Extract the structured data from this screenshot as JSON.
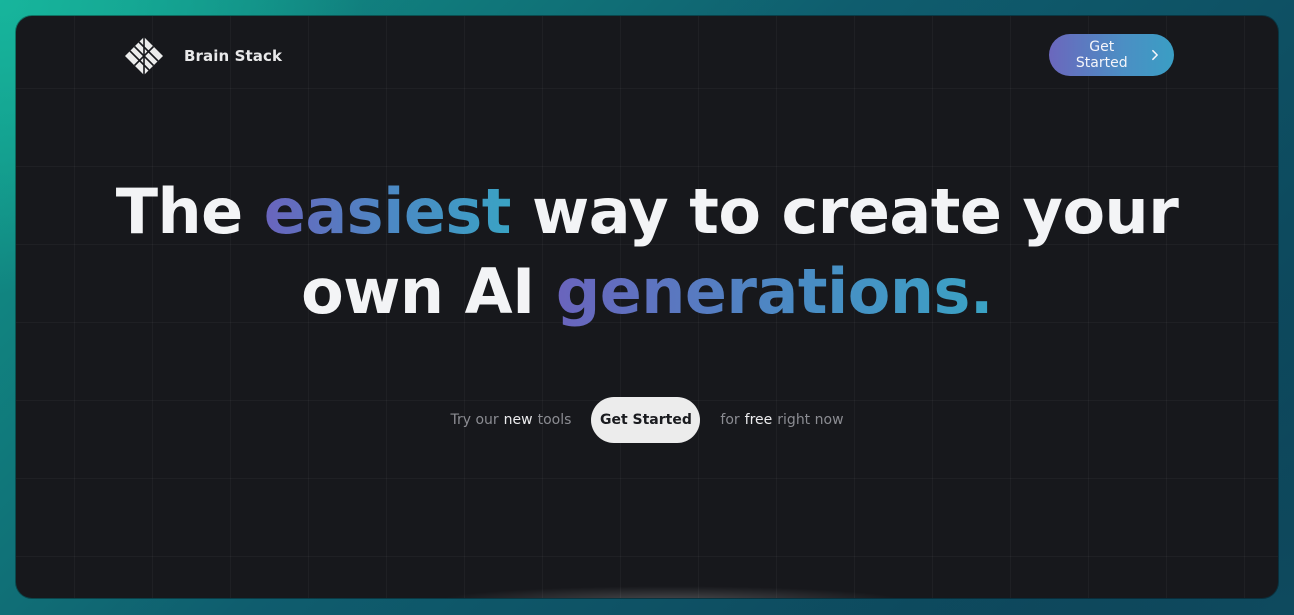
{
  "brand": {
    "name": "Brain Stack",
    "logo_icon": "diamond-grid-icon"
  },
  "nav": {
    "cta_label": "Get Started",
    "cta_icon": "chevron-right-icon"
  },
  "hero": {
    "line1_part1": "The",
    "line1_highlight": "easiest",
    "line1_part2": "way to create your",
    "line2_part1": "own AI",
    "line2_highlight": "generations."
  },
  "cta_row": {
    "left_text_1": "Try our",
    "left_text_bold": "new",
    "left_text_2": "tools",
    "button_label": "Get Started",
    "right_text_1": "for",
    "right_text_bold": "free",
    "right_text_2": "right now"
  },
  "colors": {
    "background_gradient_start": "#17b59c",
    "background_gradient_end": "#0c3f55",
    "panel": "#17181c",
    "accent_gradient_start": "#6a64bd",
    "accent_gradient_end": "#3aa3c4",
    "primary_button_bg": "#ececec"
  }
}
